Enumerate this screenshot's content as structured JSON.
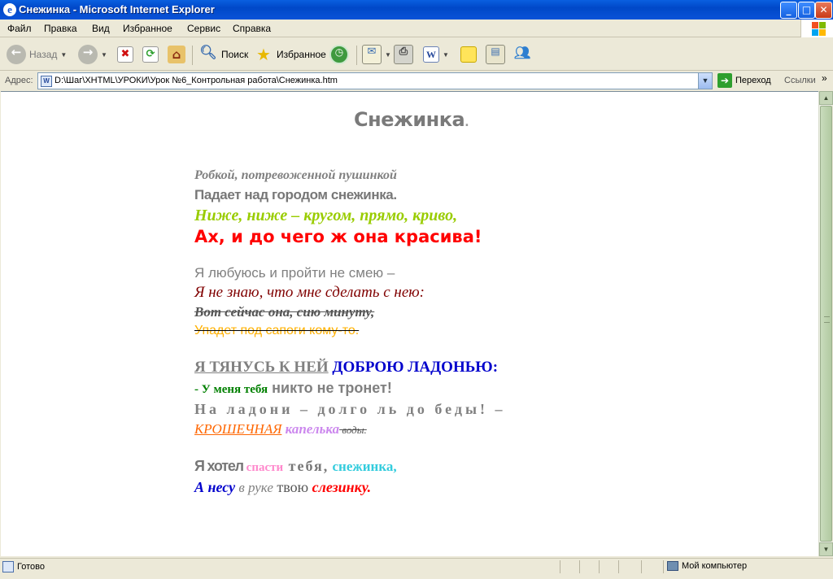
{
  "window": {
    "title": "Снежинка - Microsoft Internet Explorer",
    "ie_icon_glyph": "e",
    "controls": {
      "minimize": "_",
      "maximize": "□",
      "close": "✕"
    }
  },
  "menu": [
    "Файл",
    "Правка",
    "Вид",
    "Избранное",
    "Сервис",
    "Справка"
  ],
  "toolbar": {
    "back": {
      "label": "Назад",
      "icon": "back-arrow-icon"
    },
    "forward": {
      "icon": "forward-arrow-icon"
    },
    "stop": {
      "icon": "stop-icon"
    },
    "refresh": {
      "icon": "refresh-icon"
    },
    "home": {
      "icon": "home-icon"
    },
    "search": {
      "label": "Поиск",
      "icon": "search-icon"
    },
    "favorites": {
      "label": "Избранное",
      "icon": "star-icon"
    },
    "history": {
      "icon": "history-icon"
    },
    "mail": {
      "icon": "mail-icon"
    },
    "print": {
      "icon": "printer-icon"
    },
    "edit": {
      "icon": "word-icon",
      "glyph": "W"
    },
    "discuss": {
      "icon": "note-icon"
    },
    "research": {
      "icon": "research-icon"
    },
    "messenger": {
      "icon": "messenger-icon"
    }
  },
  "address": {
    "label": "Адрес:",
    "doc_glyph": "W",
    "url": "D:\\Шаг\\XHTML\\УРОКИ\\Урок №6_Контрольная работа\\Снежинка.htm",
    "go_label": "Переход",
    "links_label": "Ссылки",
    "more_glyph": "»"
  },
  "poem": {
    "title": "Снежинка",
    "title_dot": ".",
    "stanza1": [
      "Робкой, потревоженной пушинкой",
      "Падает над городом снежинка.",
      "Ниже, ниже – кругом, прямо, криво,",
      "Ах, и до чего ж она красива!"
    ],
    "stanza2": [
      "Я любуюсь и пройти не смею –",
      "Я не знаю, что мне сделать с нею:",
      "Вот сейчас она, сию минуту,",
      "Упадет под сапоги кому-то."
    ],
    "stanza3": {
      "line1": [
        "Я ТЯНУСЬ К НЕЙ",
        " ДОБРОЮ ЛАДОНЬЮ:"
      ],
      "line2": [
        "-  У меня тебя",
        " никто не тронет!"
      ],
      "line3": "На ладони – долго ль до беды! –",
      "line4": [
        "КРОШЕЧНАЯ",
        " капелька",
        " воды."
      ]
    },
    "stanza4": {
      "line1": [
        "Я хотел",
        " спасти",
        " тебя,",
        " снежинка,"
      ],
      "line2": [
        "А несу",
        " в руке",
        " твою",
        " слезинку."
      ]
    }
  },
  "colors": {
    "gray": "#808080",
    "yellowgreen": "#99CC00",
    "red": "#FF0000",
    "maroon": "#800000",
    "gold": "#FFB000",
    "blue": "#0000CC",
    "green": "#008000",
    "orange": "#FF6600",
    "violet": "#CC88EE",
    "pink": "#FF88CC",
    "cyan": "#33CCDD"
  },
  "status": {
    "text": "Готово",
    "zone": "Мой компьютер"
  },
  "scrollbar": {
    "up": "▲",
    "down": "▼"
  }
}
